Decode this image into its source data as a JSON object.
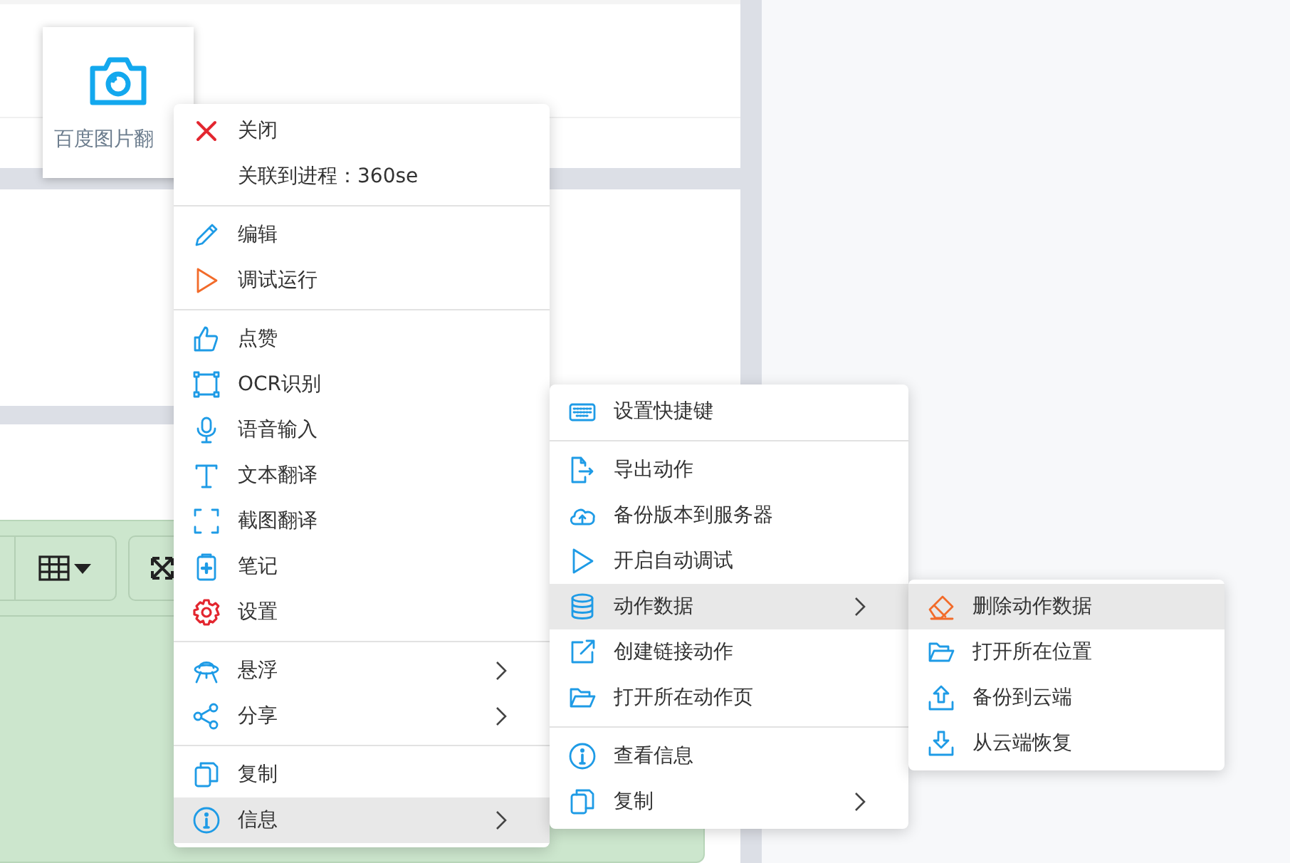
{
  "card": {
    "label": "百度图片翻"
  },
  "menus": [
    {
      "groups": [
        [
          {
            "label": "关闭",
            "submenu": false,
            "selected": false
          },
          {
            "label": "关联到进程：360se",
            "submenu": false,
            "selected": false
          }
        ],
        [
          {
            "label": "编辑",
            "submenu": false,
            "selected": false
          },
          {
            "label": "调试运行",
            "submenu": false,
            "selected": false
          }
        ],
        [
          {
            "label": "点赞",
            "submenu": false,
            "selected": false
          },
          {
            "label": "OCR识别",
            "submenu": false,
            "selected": false
          },
          {
            "label": "语音输入",
            "submenu": false,
            "selected": false
          },
          {
            "label": "文本翻译",
            "submenu": false,
            "selected": false
          },
          {
            "label": "截图翻译",
            "submenu": false,
            "selected": false
          },
          {
            "label": "笔记",
            "submenu": false,
            "selected": false
          },
          {
            "label": "设置",
            "submenu": false,
            "selected": false
          }
        ],
        [
          {
            "label": "悬浮",
            "submenu": true,
            "selected": false
          },
          {
            "label": "分享",
            "submenu": true,
            "selected": false
          }
        ],
        [
          {
            "label": "复制",
            "submenu": false,
            "selected": false
          },
          {
            "label": "信息",
            "submenu": true,
            "selected": true
          }
        ]
      ]
    },
    {
      "groups": [
        [
          {
            "label": "设置快捷键",
            "submenu": false,
            "selected": false
          }
        ],
        [
          {
            "label": "导出动作",
            "submenu": false,
            "selected": false
          },
          {
            "label": "备份版本到服务器",
            "submenu": false,
            "selected": false
          },
          {
            "label": "开启自动调试",
            "submenu": false,
            "selected": false
          },
          {
            "label": "动作数据",
            "submenu": true,
            "selected": true
          },
          {
            "label": "创建链接动作",
            "submenu": false,
            "selected": false
          },
          {
            "label": "打开所在动作页",
            "submenu": false,
            "selected": false
          }
        ],
        [
          {
            "label": "查看信息",
            "submenu": false,
            "selected": false
          },
          {
            "label": "复制",
            "submenu": true,
            "selected": false
          }
        ]
      ]
    },
    {
      "groups": [
        [
          {
            "label": "删除动作数据",
            "submenu": false,
            "selected": true
          },
          {
            "label": "打开所在位置",
            "submenu": false,
            "selected": false
          },
          {
            "label": "备份到云端",
            "submenu": false,
            "selected": false
          },
          {
            "label": "从云端恢复",
            "submenu": false,
            "selected": false
          }
        ]
      ]
    }
  ]
}
